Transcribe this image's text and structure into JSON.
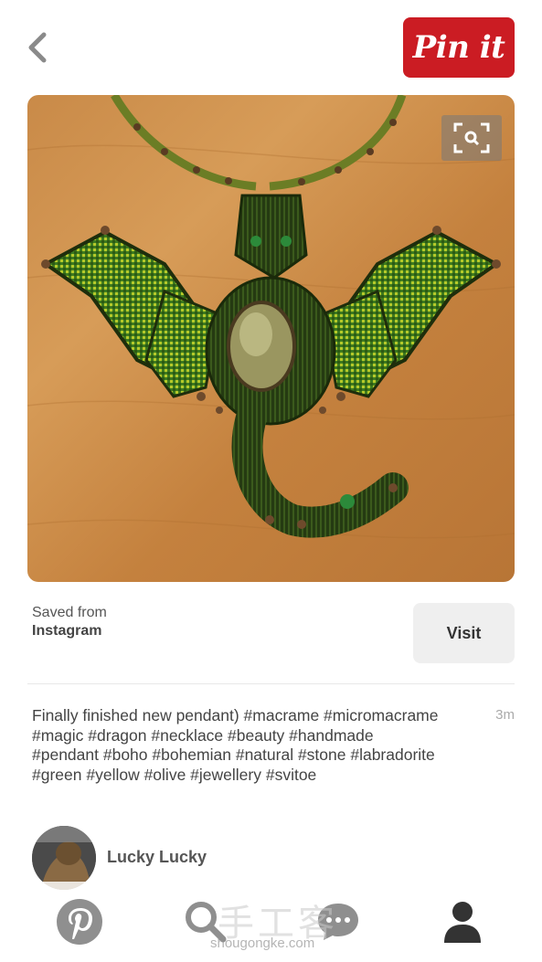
{
  "header": {
    "back_icon": "chevron-left-icon",
    "pin_button_label": "Pin it",
    "pin_button_color": "#cb1c23"
  },
  "pin": {
    "lens_icon": "visual-search-icon"
  },
  "source": {
    "saved_from_label": "Saved from",
    "name": "Instagram",
    "visit_label": "Visit"
  },
  "description": {
    "text": "Finally finished new pendant) #macrame #micromacrame #magic #dragon #necklace #beauty #handmade #pendant #boho #bohemian #natural #stone #labradorite #green #yellow #olive #jewellery #svitoe",
    "timestamp": "3m"
  },
  "user": {
    "name": "Lucky Lucky"
  },
  "tab_bar": {
    "tabs": [
      {
        "icon": "pinterest-logo-icon"
      },
      {
        "icon": "search-icon"
      },
      {
        "icon": "chat-bubble-icon"
      },
      {
        "icon": "profile-icon"
      }
    ]
  },
  "watermark": {
    "chinese": "手工客",
    "site": "shougongke.com"
  }
}
